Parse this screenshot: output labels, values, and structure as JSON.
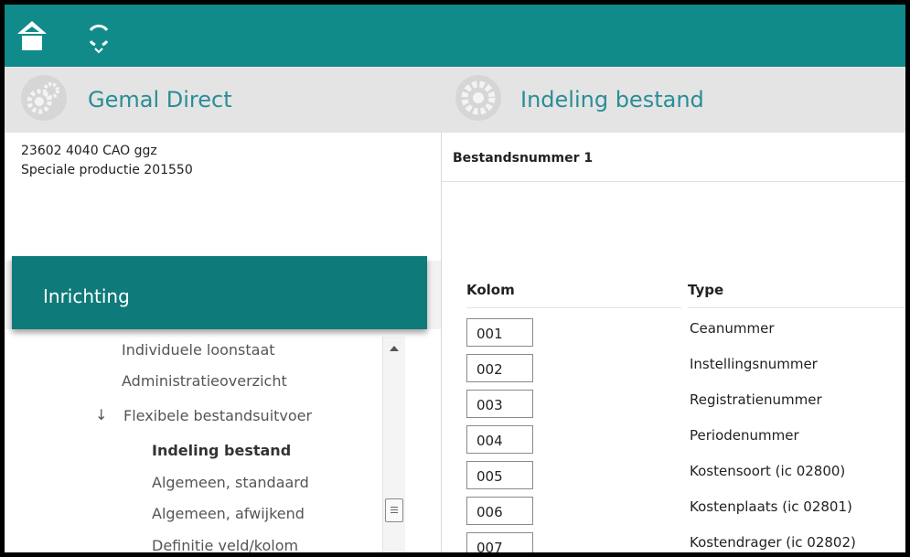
{
  "topbar": {
    "home_icon": "home-icon",
    "sync_icon": "sync-icon"
  },
  "left_header": {
    "title": "Gemal Direct",
    "logo_icon": "gears-logo-icon"
  },
  "right_header": {
    "title": "Indeling bestand",
    "logo_icon": "gear-logo-icon"
  },
  "context": {
    "line1": "23602 4040 CAO ggz",
    "line2": "Speciale productie  201550"
  },
  "section": {
    "title": "Inrichting"
  },
  "nav": {
    "items": [
      {
        "label": "Individuele loonstaat"
      },
      {
        "label": "Administratieoverzicht"
      },
      {
        "label": "Flexibele bestandsuitvoer",
        "arrow": "↓"
      },
      {
        "label": "Indeling bestand",
        "active": true
      },
      {
        "label": "Algemeen, standaard"
      },
      {
        "label": "Algemeen, afwijkend"
      },
      {
        "label": "Definitie veld/kolom"
      }
    ]
  },
  "content": {
    "title": "Bestandsnummer 1",
    "headers": {
      "kolom": "Kolom",
      "type": "Type"
    },
    "rows": [
      {
        "kolom": "001",
        "type": "Ceanummer"
      },
      {
        "kolom": "002",
        "type": "Instellingsnummer"
      },
      {
        "kolom": "003",
        "type": "Registratienummer"
      },
      {
        "kolom": "004",
        "type": "Periodenummer"
      },
      {
        "kolom": "005",
        "type": "Kostensoort (ic 02800)"
      },
      {
        "kolom": "006",
        "type": "Kostenplaats (ic 02801)"
      },
      {
        "kolom": "007",
        "type": "Kostendrager (ic 02802)"
      }
    ]
  },
  "colors": {
    "topbar": "#118a8a",
    "section_header": "#0f7a7a",
    "header_title": "#2a8d96",
    "header_bg": "#e4e4e4"
  }
}
